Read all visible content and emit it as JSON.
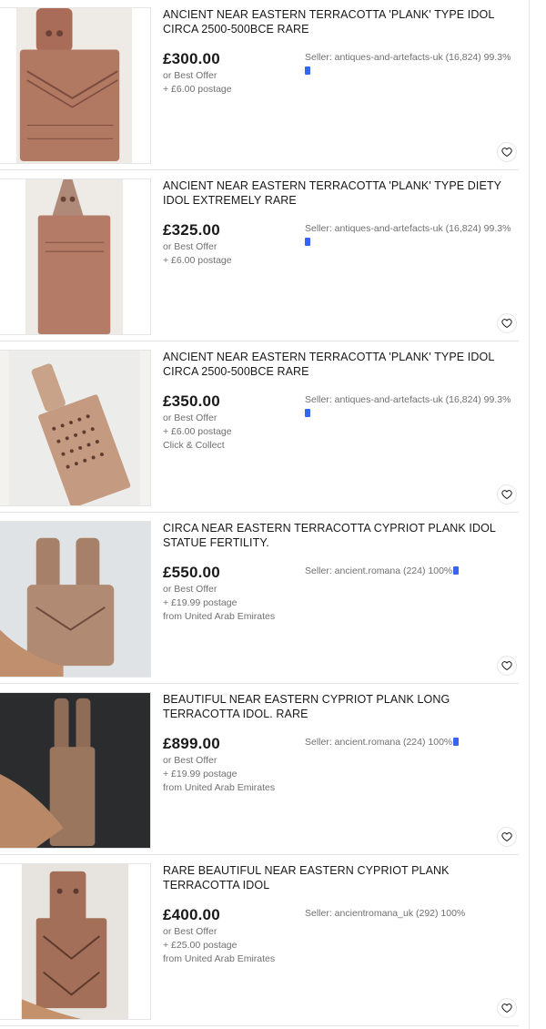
{
  "listings": [
    {
      "title": "ANCIENT NEAR EASTERN TERRACOTTA 'PLANK' TYPE IDOL CIRCA 2500-500BCE RARE",
      "price": "£300.00",
      "lines": [
        "or Best Offer",
        "+ £6.00 postage"
      ],
      "seller": "Seller: antiques-and-artefacts-uk (16,824) 99.3%",
      "seller_icon_newline": true
    },
    {
      "title": "ANCIENT NEAR EASTERN TERRACOTTA 'PLANK' TYPE DIETY IDOL EXTREMELY RARE",
      "price": "£325.00",
      "lines": [
        "or Best Offer",
        "+ £6.00 postage"
      ],
      "seller": "Seller: antiques-and-artefacts-uk (16,824) 99.3%",
      "seller_icon_newline": true
    },
    {
      "title": "ANCIENT NEAR EASTERN TERRACOTTA 'PLANK' TYPE IDOL CIRCA 2500-500BCE RARE",
      "price": "£350.00",
      "lines": [
        "or Best Offer",
        "+ £6.00 postage",
        "Click & Collect"
      ],
      "seller": "Seller: antiques-and-artefacts-uk (16,824) 99.3%",
      "seller_icon_newline": true
    },
    {
      "title": "CIRCA NEAR EASTERN TERRACOTTA CYPRIOT PLANK IDOL STATUE FERTILITY.",
      "price": "£550.00",
      "lines": [
        "or Best Offer",
        "+ £19.99 postage",
        "from United Arab Emirates"
      ],
      "seller": "Seller: ancient.romana (224) 100%",
      "seller_icon_newline": false
    },
    {
      "title": "BEAUTIFUL NEAR EASTERN CYPRIOT PLANK LONG TERRACOTTA IDOL. RARE",
      "price": "£899.00",
      "lines": [
        "or Best Offer",
        "+ £19.99 postage",
        "from United Arab Emirates"
      ],
      "seller": "Seller: ancient.romana (224) 100%",
      "seller_icon_newline": false
    },
    {
      "title": "RARE BEAUTIFUL NEAR EASTERN CYPRIOT PLANK TERRACOTTA IDOL",
      "price": "£400.00",
      "lines": [
        "or Best Offer",
        "+ £25.00 postage",
        "from United Arab Emirates"
      ],
      "seller": "Seller: ancientromana_uk (292) 100%",
      "seller_icon_newline": null
    }
  ],
  "colors": {
    "price": "#191919",
    "meta": "#707070",
    "accent": "#3665f3",
    "divider": "#e5e5e5"
  },
  "icons": {
    "watch": "heart-icon",
    "seller_badge": "shield-icon"
  }
}
